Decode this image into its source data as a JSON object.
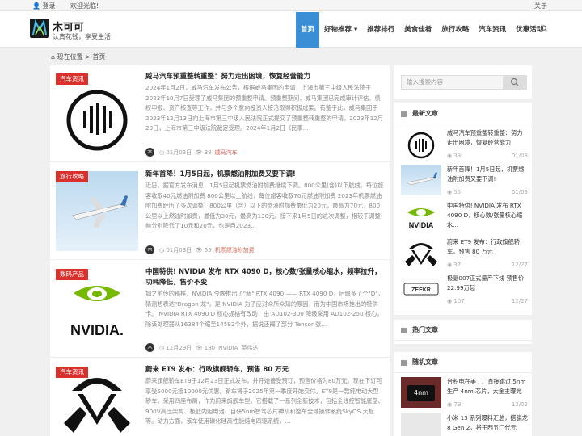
{
  "topbar": {
    "login": "登录",
    "welcome": "欢迎光临!",
    "about": "关于"
  },
  "site": {
    "name": "木可可",
    "slogan": "认真花钱，享受生活"
  },
  "nav": [
    "首页",
    "好物推荐 ▾",
    "推荐排行",
    "美食佳肴",
    "旅行攻略",
    "汽车资讯",
    "优惠活动"
  ],
  "breadcrumb": {
    "label": "现在位置",
    "home": "首页"
  },
  "articles": [
    {
      "category": "汽车资讯",
      "title": "威马汽车预重整转重整：努力走出困境，恢复经营能力",
      "excerpt": "2024年1月2日，威马汽车发布公告，根据威马集团的申请，上海市第三中级人民法院于2023年10月7日受理了威马集团的预重整申请。预重整期间，威马集团已完成审计评估、债权申报、资产核查等工作，并与多个意向投资人接洽取得积极成果。有鉴于此，威马集团于2023年12月13日向上海市第三中级人民法院正式提交了预重整转重整的申请。2023年12月29日，上海市第三中级法院裁定受理。2024年1月2日《民事...",
      "avatar": "木",
      "date": "01月03日",
      "views": "39",
      "tags": [
        "威马汽车"
      ]
    },
    {
      "category": "旅行攻略",
      "title": "新年首降！1月5日起，机票燃油附加费又要下调!",
      "excerpt": "近日，据官方发布消息，1月5日起机票燃油附加费继续下调。800公里(含)以下航线，每位旅客收取40元燃油附加费 800公里以上航线，每位旅客收取70元燃油附加费 2023年机票燃油附加费经历了多次调整，800公里（含）以下的燃油附加费最低为20元，最高为70元，800公里以上燃油附加费，最低为30元，最高为130元。接下来1月5日的这次调整，相较于调整前分别降低了10元和20元，也是自2023...",
      "avatar": "木",
      "date": "01月03日",
      "views": "55",
      "tags": [
        "机票燃油附加费"
      ]
    },
    {
      "category": "数码产品",
      "title": "中国特供! NVIDIA 发布 RTX 4090 D，核心数/张量核心缩水，频率拉升，功耗降低，售价不变",
      "excerpt": "如之前传的那样，NVIDIA 今晚推出了\"新\" RTX 4090 —— RTX 4090 D，后缀多了个\"D\"，猜测想表达\"Dragon 龙\"，是 NVIDIA 为了应对众所众知的原因，而为中国市场推出的特供卡。 NVIDIA RTX 4090 D 核心规格有改动，由 AD102-300 降级采用 AD102-250 核心，除该处理器从16384个缩至14592个外，据说还阉了部分 Tensor 张...",
      "avatar": "木",
      "date": "12月29日",
      "views": "180",
      "tags": [
        "NVIDIA",
        "英伟达"
      ]
    },
    {
      "category": "汽车资讯",
      "title": "蔚来 ET9 发布：行政旗舰轿车，预售 80 万元",
      "excerpt": "蔚来旗舰轿车ET9于12月23日正式发布，并开始接受预订，预售价格为80万元。现在下订可享受5000元抵10000元优惠。新车将于2025年第一季度开始交付。ET9是一款纯电动大型轿车，采用四座布局，作为蔚来旗舰车型，它搭载了一系列全新技术，包括全线控智能底盘、900V高压架构、极低内阻电池、自研5nm智驾芯片神玑和整车全域操作系统SkyOS 天枢等。动力方面，该车使用碳化硅高性能纯电四驱系统，...",
      "avatar": "木",
      "date": "12月27日",
      "views": "37",
      "tags": [
        "蔚来"
      ]
    }
  ],
  "sidebar": {
    "search_placeholder": "输入搜索内容",
    "latest_title": "最新文章",
    "hot_title": "热门文章",
    "random_title": "随机文章",
    "latest": [
      {
        "title": "威马汽车预重整转重整：努力走出困境，恢复经营能力",
        "views": "39",
        "date": "01/03"
      },
      {
        "title": "新年首降！1月5日起，机票燃油附加费又要下调!",
        "views": "55",
        "date": "01/03"
      },
      {
        "title": "中国特供! NVIDIA 发布 RTX 4090 D，核心数/张量核心缩水...",
        "views": "",
        "date": ""
      },
      {
        "title": "蔚来 ET9 发布：行政旗舰轿车，预售 80 万元",
        "views": "37",
        "date": "12/27"
      },
      {
        "title": "极氪007正式量产下线 预售价22.99万起",
        "views": "107",
        "date": "12/27"
      }
    ],
    "random": [
      {
        "title": "台积电在美工厂直接跳过 5nm 生产 4nm 芯片，大金主曝光",
        "views": "79",
        "date": "12/02",
        "thumb_text": "4nm"
      },
      {
        "title": "小米 13 系列曝料汇总，搭骁龙 8 Gen 2，将于西五门代元",
        "views": "",
        "date": ""
      }
    ]
  },
  "colors": {
    "accent": "#3a8ed6",
    "category": "#d9302c"
  }
}
